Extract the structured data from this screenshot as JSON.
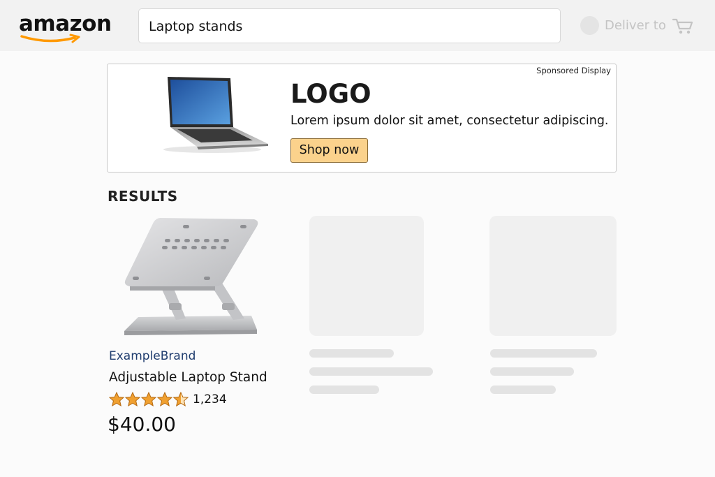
{
  "header": {
    "logo_text": "amazon",
    "search": {
      "value": "Laptop stands"
    },
    "deliver_label": "Deliver to",
    "cart_icon": "cart-icon"
  },
  "ad": {
    "sponsored_label": "Sponsored Display",
    "logo": "LOGO",
    "copy": "Lorem ipsum dolor sit amet, consectetur adipiscing.",
    "button_label": "Shop now",
    "button_color": "#fbd28c"
  },
  "results": {
    "heading": "RESULTS",
    "products": [
      {
        "brand": "ExampleBrand",
        "title": "Adjustable Laptop Stand",
        "rating": 4.5,
        "rating_count": "1,234",
        "price": "$40.00"
      }
    ]
  },
  "colors": {
    "brand_link": "#1f3c6e",
    "star": "#f0a030",
    "logo_smile": "#ff9900"
  }
}
